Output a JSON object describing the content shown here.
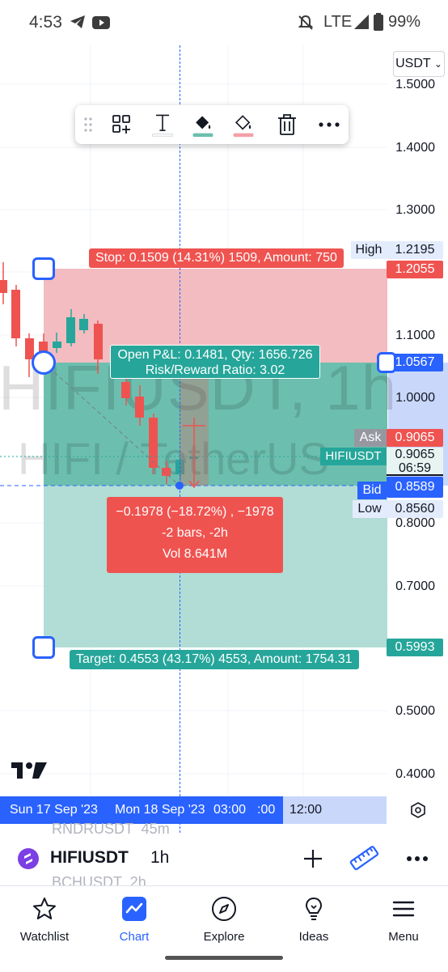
{
  "status_bar": {
    "time": "4:53",
    "network": "LTE",
    "battery": "99%",
    "icons": [
      "telegram-icon",
      "youtube-icon",
      "mute-icon",
      "signal-icon",
      "battery-icon"
    ]
  },
  "currency_selector": "USDT",
  "price_axis": [
    "1.5000",
    "1.4000",
    "1.3000",
    "1.1000",
    "1.0000",
    "0.8000",
    "0.7000",
    "0.5000",
    "0.4000"
  ],
  "price_labels": {
    "high_label": "High",
    "high_value": "1.2195",
    "stop_price": "1.2055",
    "entry_price": "1.0567",
    "ask_label": "Ask",
    "ask_value": "0.9065",
    "symbol_label": "HIFIUSDT",
    "last_price": "0.9065",
    "countdown": "06:59",
    "bid_label": "Bid",
    "bid_value": "0.8589",
    "low_label": "Low",
    "low_value": "0.8560",
    "target_price": "0.5993"
  },
  "watermark": {
    "line1": "HIFIUSDT, 1h",
    "line2": "HIFI / TetherUS"
  },
  "drawing_toolbar": [
    "drag-handle-icon",
    "add-to-group-icon",
    "text-icon",
    "fill-color-icon",
    "line-color-icon",
    "trash-icon",
    "more-icon"
  ],
  "position": {
    "stop_text": "Stop: 0.1509 (14.31%) 1509, Amount: 750",
    "pnl_line1": "Open P&L: 0.1481, Qty: 1656.726",
    "pnl_line2": "Risk/Reward Ratio: 3.02",
    "target_text": "Target: 0.4553 (43.17%) 4553, Amount: 1754.31"
  },
  "measure": {
    "line1": "−0.1978 (−18.72%) , −1978",
    "line2": "-2 bars, -2h",
    "line3": "Vol 8.641M"
  },
  "time_axis": {
    "date1": "Sun 17 Sep '23",
    "date2": "Mon 18 Sep '23",
    "time1": "03:00",
    "time2": ":00",
    "time3": "12:00"
  },
  "behind_list": {
    "item1": "RNDRUSDT  45m",
    "item2": "BCHUSDT  2h"
  },
  "symbol_bar": {
    "symbol": "HIFIUSDT",
    "interval": "1h"
  },
  "nav": {
    "watchlist": "Watchlist",
    "chart": "Chart",
    "explore": "Explore",
    "ideas": "Ideas",
    "menu": "Menu"
  },
  "colors": {
    "stop_zone": "#f2bcc0",
    "target_zone": "#b2ddd6",
    "target_zone_dark": "#6cbfaf",
    "red": "#ef5350",
    "green": "#26a69a",
    "accent": "#2962ff"
  }
}
